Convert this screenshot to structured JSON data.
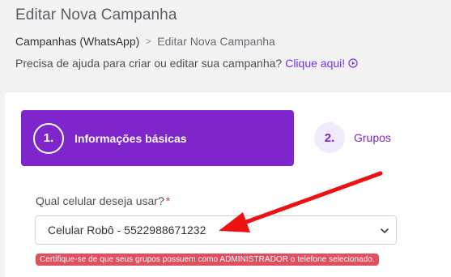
{
  "header": {
    "title": "Editar Nova Campanha",
    "breadcrumb": {
      "root": "Campanhas (WhatsApp)",
      "separator": ">",
      "current": "Editar Nova Campanha"
    },
    "help": {
      "text": "Precisa de ajuda para criar ou editar sua campanha?",
      "link": "Clique aqui!"
    }
  },
  "steps": [
    {
      "number": "1.",
      "label": "Informações básicas",
      "active": true
    },
    {
      "number": "2.",
      "label": "Grupos",
      "active": false
    }
  ],
  "form": {
    "phone_field": {
      "label": "Qual celular deseja usar?",
      "required_mark": "*",
      "value": "Celular Robô - 5522988671232",
      "warning": "Certifique-se de que seus grupos possuem como ADMINISTRADOR o telefone selecionado."
    }
  },
  "colors": {
    "accent": "#7e25cc",
    "warning": "#e04f5f",
    "arrow": "#ee1111"
  },
  "icons": [
    "play-circle-icon",
    "chevron-down-icon",
    "annotation-arrow"
  ]
}
